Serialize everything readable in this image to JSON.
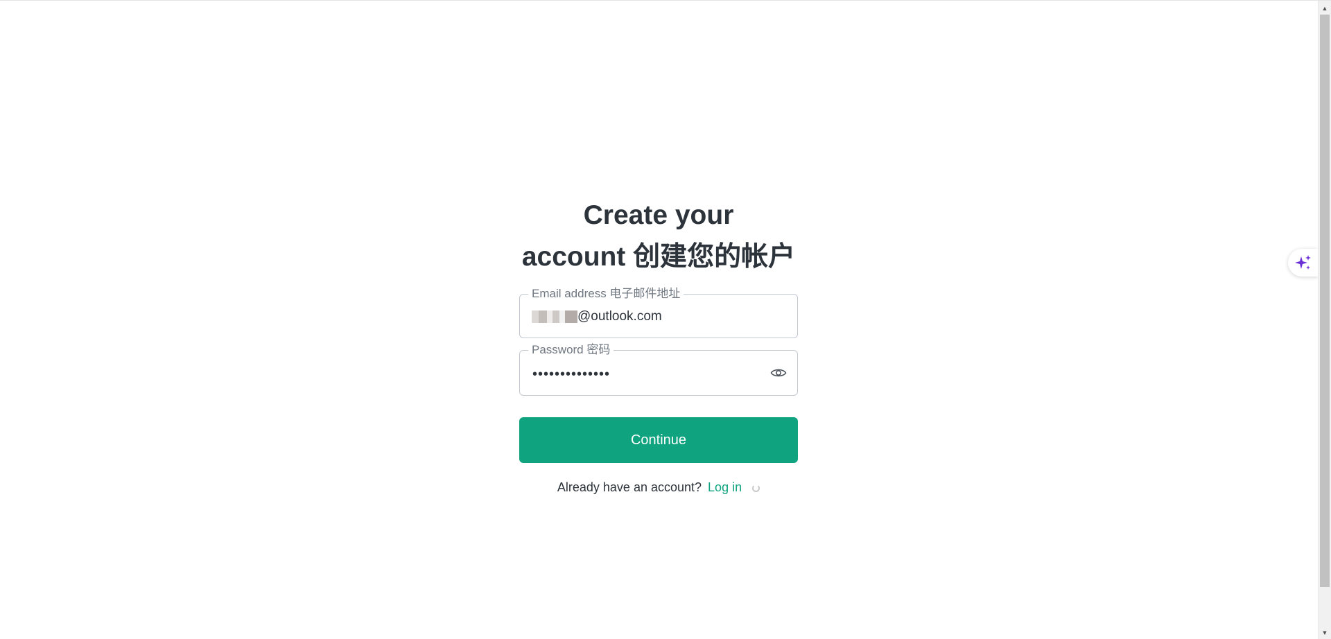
{
  "signup": {
    "title_line1": "Create your",
    "title_line2": "account 创建您的帐户",
    "email": {
      "label": "Email address 电子邮件地址",
      "value_suffix": "@outlook.com"
    },
    "password": {
      "label": "Password 密码",
      "masked_value": "••••••••••••••",
      "toggle_icon": "eye-icon"
    },
    "continue_label": "Continue",
    "login_prompt": "Already have an account?",
    "login_link": "Log in"
  },
  "side_widget": {
    "icon": "sparkle-icon",
    "color": "#6b2fd6"
  },
  "colors": {
    "accent": "#10a37f",
    "text": "#2d333a",
    "border": "#c2c8d0",
    "label": "#6f7780"
  }
}
